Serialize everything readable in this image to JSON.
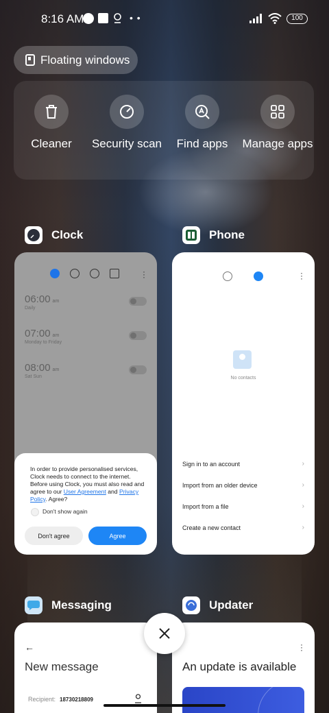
{
  "status_bar": {
    "time": "8:16 AM",
    "battery": "100"
  },
  "floating_windows": {
    "label": "Floating windows"
  },
  "quick_actions": [
    {
      "label": "Cleaner",
      "icon": "trash-icon"
    },
    {
      "label": "Security scan",
      "icon": "security-scan-icon"
    },
    {
      "label": "Find apps",
      "icon": "find-apps-icon"
    },
    {
      "label": "Manage apps",
      "icon": "grid-icon"
    }
  ],
  "apps": {
    "clock": {
      "name": "Clock",
      "alarms": [
        {
          "time": "06:00",
          "ampm": "am",
          "repeat": "Daily"
        },
        {
          "time": "07:00",
          "ampm": "am",
          "repeat": "Monday to Friday"
        },
        {
          "time": "08:00",
          "ampm": "am",
          "repeat": "Sat Sun"
        }
      ],
      "consent": {
        "text_before": "In order to provide personalised services, Clock needs to connect to the internet. Before using Clock, you must also read and agree to our ",
        "user_agreement": "User Agreement",
        "and": " and ",
        "privacy_policy": "Privacy Policy",
        "text_after": ". Agree?",
        "dont_show": "Don't show again",
        "disagree": "Don't agree",
        "agree": "Agree"
      }
    },
    "phone": {
      "name": "Phone",
      "empty": "No contacts",
      "items": [
        "Sign in to an account",
        "Import from an older device",
        "Import from a file",
        "Create a new contact"
      ]
    },
    "messaging": {
      "name": "Messaging",
      "title": "New message",
      "recipient_label": "Recipient:",
      "recipient_value": "18730218809"
    },
    "updater": {
      "name": "Updater",
      "title": "An update is available"
    }
  },
  "colors": {
    "accent": "#1e86f5",
    "card_bg": "#ffffff"
  }
}
